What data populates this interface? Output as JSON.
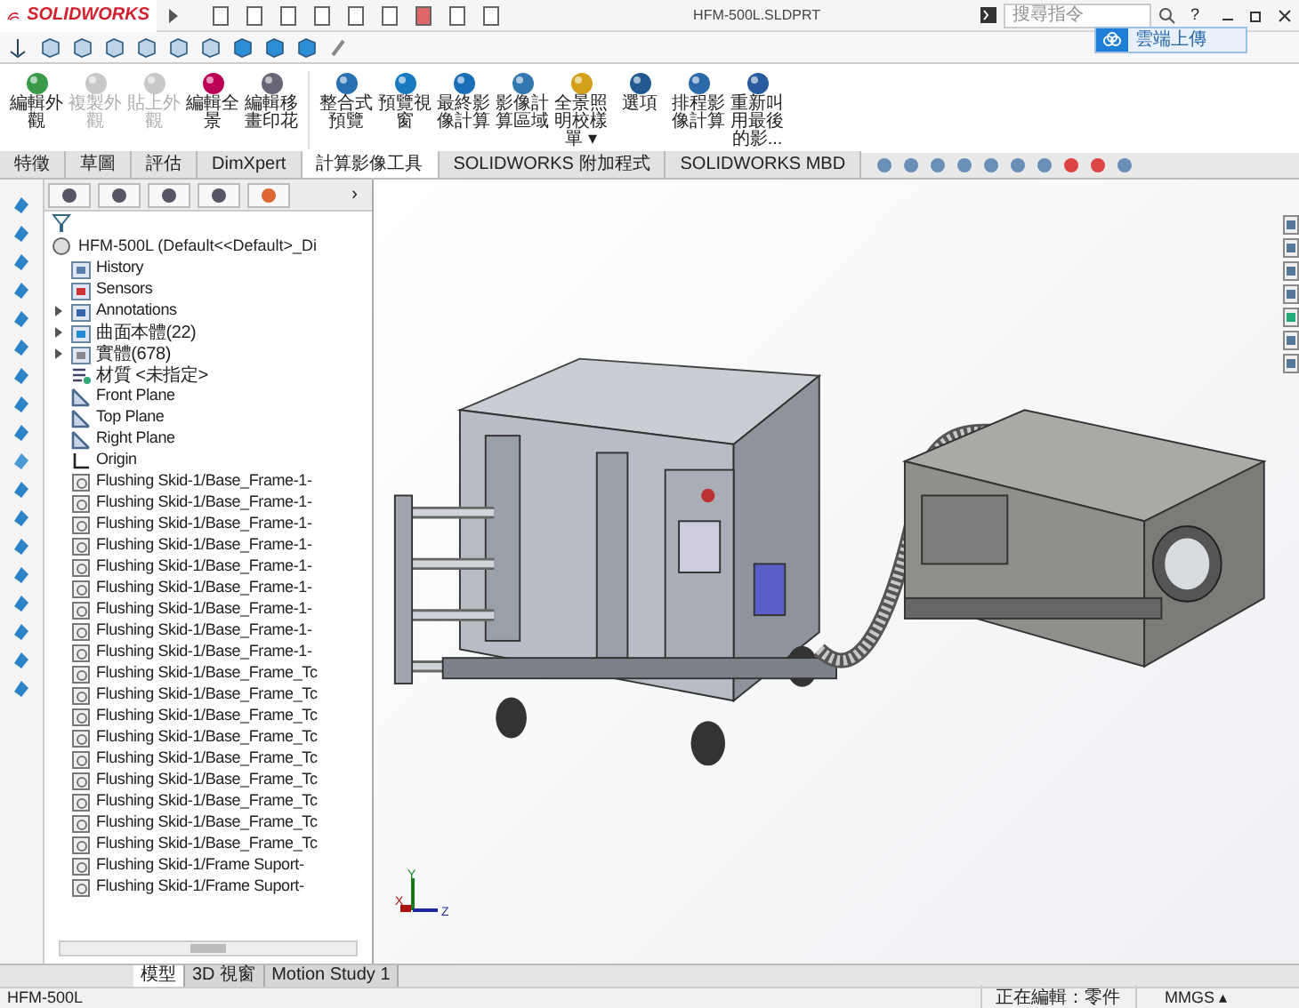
{
  "app": {
    "logo": "SOLIDWORKS",
    "title": "HFM-500L.SLDPRT",
    "search": {
      "placeholder": "搜尋指令"
    },
    "help": "?"
  },
  "upload_button": "雲端上傳",
  "ribbon": [
    {
      "label": "編輯外觀",
      "disabled": false
    },
    {
      "label": "複製外觀",
      "disabled": true
    },
    {
      "label": "貼上外觀",
      "disabled": true
    },
    {
      "label": "編輯全景",
      "disabled": false
    },
    {
      "label": "編輯移畫印花",
      "disabled": false
    },
    {
      "label": "整合式預覽",
      "disabled": false
    },
    {
      "label": "預覽視窗",
      "disabled": false
    },
    {
      "label": "最終影像計算",
      "disabled": false
    },
    {
      "label": "影像計算區域",
      "disabled": false
    },
    {
      "label": "全景照明校樣單 ▾",
      "disabled": false
    },
    {
      "label": "選項",
      "disabled": false
    },
    {
      "label": "排程影像計算",
      "disabled": false
    },
    {
      "label": "重新叫用最後的影...",
      "disabled": false
    }
  ],
  "tabs": [
    {
      "label": "特徵",
      "selected": false
    },
    {
      "label": "草圖",
      "selected": false
    },
    {
      "label": "評估",
      "selected": false
    },
    {
      "label": "DimXpert",
      "selected": false
    },
    {
      "label": "計算影像工具",
      "selected": true
    },
    {
      "label": "SOLIDWORKS 附加程式",
      "selected": false
    },
    {
      "label": "SOLIDWORKS MBD",
      "selected": false
    }
  ],
  "tree": {
    "root": "HFM-500L  (Default<<Default>_Di",
    "more": "›",
    "items": [
      {
        "label": "History",
        "kind": "history"
      },
      {
        "label": "Sensors",
        "kind": "sensors"
      },
      {
        "label": "Annotations",
        "kind": "annotations",
        "expanded": false
      },
      {
        "label": "曲面本體(22)",
        "kind": "surface",
        "expanded": false
      },
      {
        "label": "實體(678)",
        "kind": "solid",
        "expanded": false
      },
      {
        "label": "材質 <未指定>",
        "kind": "material"
      },
      {
        "label": "Front Plane",
        "kind": "plane"
      },
      {
        "label": "Top Plane",
        "kind": "plane"
      },
      {
        "label": "Right Plane",
        "kind": "plane"
      },
      {
        "label": "Origin",
        "kind": "origin"
      },
      {
        "label": "Flushing Skid-1/Base_Frame-1-",
        "kind": "part"
      },
      {
        "label": "Flushing Skid-1/Base_Frame-1-",
        "kind": "part"
      },
      {
        "label": "Flushing Skid-1/Base_Frame-1-",
        "kind": "part"
      },
      {
        "label": "Flushing Skid-1/Base_Frame-1-",
        "kind": "part"
      },
      {
        "label": "Flushing Skid-1/Base_Frame-1-",
        "kind": "part"
      },
      {
        "label": "Flushing Skid-1/Base_Frame-1-",
        "kind": "part"
      },
      {
        "label": "Flushing Skid-1/Base_Frame-1-",
        "kind": "part"
      },
      {
        "label": "Flushing Skid-1/Base_Frame-1-",
        "kind": "part"
      },
      {
        "label": "Flushing Skid-1/Base_Frame-1-",
        "kind": "part"
      },
      {
        "label": "Flushing Skid-1/Base_Frame_Tc",
        "kind": "part"
      },
      {
        "label": "Flushing Skid-1/Base_Frame_Tc",
        "kind": "part"
      },
      {
        "label": "Flushing Skid-1/Base_Frame_Tc",
        "kind": "part"
      },
      {
        "label": "Flushing Skid-1/Base_Frame_Tc",
        "kind": "part"
      },
      {
        "label": "Flushing Skid-1/Base_Frame_Tc",
        "kind": "part"
      },
      {
        "label": "Flushing Skid-1/Base_Frame_Tc",
        "kind": "part"
      },
      {
        "label": "Flushing Skid-1/Base_Frame_Tc",
        "kind": "part"
      },
      {
        "label": "Flushing Skid-1/Base_Frame_Tc",
        "kind": "part"
      },
      {
        "label": "Flushing Skid-1/Base_Frame_Tc",
        "kind": "part"
      },
      {
        "label": "Flushing Skid-1/Frame Suport-",
        "kind": "part"
      },
      {
        "label": "Flushing Skid-1/Frame Suport-",
        "kind": "part"
      }
    ]
  },
  "triad": [
    "X",
    "Y",
    "Z"
  ],
  "bottom_tabs": [
    {
      "label": "模型",
      "selected": true
    },
    {
      "label": "3D 視窗",
      "selected": false
    },
    {
      "label": "Motion Study 1",
      "selected": false
    }
  ],
  "status_bar": {
    "document": "HFM-500L",
    "mode": "正在編輯：零件",
    "units": "MMGS ▴"
  }
}
